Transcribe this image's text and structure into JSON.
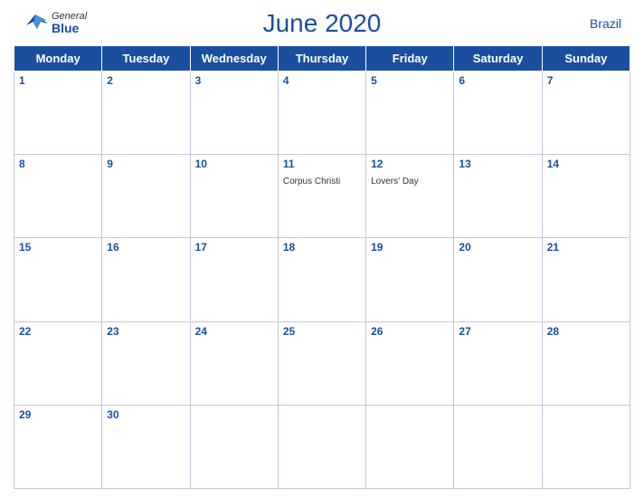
{
  "header": {
    "title": "June 2020",
    "country": "Brazil",
    "logo": {
      "general": "General",
      "blue": "Blue"
    }
  },
  "weekdays": [
    "Monday",
    "Tuesday",
    "Wednesday",
    "Thursday",
    "Friday",
    "Saturday",
    "Sunday"
  ],
  "weeks": [
    [
      {
        "day": 1,
        "events": []
      },
      {
        "day": 2,
        "events": []
      },
      {
        "day": 3,
        "events": []
      },
      {
        "day": 4,
        "events": []
      },
      {
        "day": 5,
        "events": []
      },
      {
        "day": 6,
        "events": []
      },
      {
        "day": 7,
        "events": []
      }
    ],
    [
      {
        "day": 8,
        "events": []
      },
      {
        "day": 9,
        "events": []
      },
      {
        "day": 10,
        "events": []
      },
      {
        "day": 11,
        "events": [
          "Corpus Christi"
        ]
      },
      {
        "day": 12,
        "events": [
          "Lovers' Day"
        ]
      },
      {
        "day": 13,
        "events": []
      },
      {
        "day": 14,
        "events": []
      }
    ],
    [
      {
        "day": 15,
        "events": []
      },
      {
        "day": 16,
        "events": []
      },
      {
        "day": 17,
        "events": []
      },
      {
        "day": 18,
        "events": []
      },
      {
        "day": 19,
        "events": []
      },
      {
        "day": 20,
        "events": []
      },
      {
        "day": 21,
        "events": []
      }
    ],
    [
      {
        "day": 22,
        "events": []
      },
      {
        "day": 23,
        "events": []
      },
      {
        "day": 24,
        "events": []
      },
      {
        "day": 25,
        "events": []
      },
      {
        "day": 26,
        "events": []
      },
      {
        "day": 27,
        "events": []
      },
      {
        "day": 28,
        "events": []
      }
    ],
    [
      {
        "day": 29,
        "events": []
      },
      {
        "day": 30,
        "events": []
      },
      {
        "day": null,
        "events": []
      },
      {
        "day": null,
        "events": []
      },
      {
        "day": null,
        "events": []
      },
      {
        "day": null,
        "events": []
      },
      {
        "day": null,
        "events": []
      }
    ]
  ]
}
